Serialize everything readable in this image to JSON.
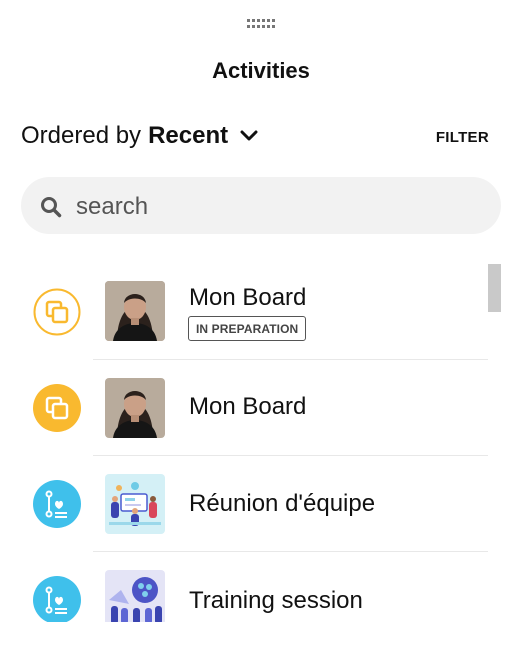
{
  "header": {
    "title": "Activities"
  },
  "ordering": {
    "prefix": "Ordered by",
    "value": "Recent"
  },
  "filter": {
    "label": "FILTER"
  },
  "search": {
    "placeholder": "search"
  },
  "items": [
    {
      "name": "Mon Board",
      "badge": "IN PREPARATION",
      "type_icon": "board-outline-icon",
      "thumbnail": "avatar-woman"
    },
    {
      "name": "Mon Board",
      "badge": "",
      "type_icon": "board-filled-icon",
      "thumbnail": "avatar-woman"
    },
    {
      "name": "Réunion d'équipe",
      "badge": "",
      "type_icon": "agenda-icon",
      "thumbnail": "meeting-illustration"
    },
    {
      "name": "Training session",
      "badge": "",
      "type_icon": "agenda-icon",
      "thumbnail": "training-illustration"
    }
  ],
  "colors": {
    "board": "#f9b92f",
    "agenda": "#3fc0eb"
  }
}
